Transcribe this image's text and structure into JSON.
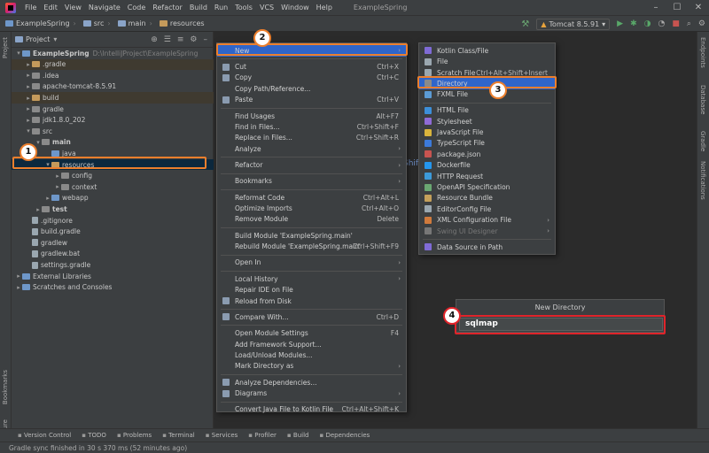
{
  "menubar": {
    "items": [
      "File",
      "Edit",
      "View",
      "Navigate",
      "Code",
      "Refactor",
      "Build",
      "Run",
      "Tools",
      "VCS",
      "Window",
      "Help"
    ],
    "title": "ExampleSpring"
  },
  "navbar": {
    "crumbs": [
      "ExampleSpring",
      "src",
      "main",
      "resources"
    ],
    "run_config": "Tomcat 8.5.91"
  },
  "project": {
    "title": "Project",
    "rows": [
      {
        "label": "ExampleSpring",
        "hint": "D:\\IntelliJProject\\ExampleSpring",
        "indent": 0,
        "arrow": "▾",
        "icon": "b",
        "state": "",
        "bold": true
      },
      {
        "label": ".gradle",
        "indent": 1,
        "arrow": "▸",
        "icon": "o",
        "state": "ex"
      },
      {
        "label": ".idea",
        "indent": 1,
        "arrow": "▸",
        "icon": "g",
        "state": ""
      },
      {
        "label": "apache-tomcat-8.5.91",
        "indent": 1,
        "arrow": "▸",
        "icon": "g",
        "state": ""
      },
      {
        "label": "build",
        "indent": 1,
        "arrow": "▸",
        "icon": "o",
        "state": "ex"
      },
      {
        "label": "gradle",
        "indent": 1,
        "arrow": "▸",
        "icon": "g",
        "state": ""
      },
      {
        "label": "jdk1.8.0_202",
        "indent": 1,
        "arrow": "▸",
        "icon": "g",
        "state": ""
      },
      {
        "label": "src",
        "indent": 1,
        "arrow": "▾",
        "icon": "g",
        "state": ""
      },
      {
        "label": "main",
        "indent": 2,
        "arrow": "▾",
        "icon": "g",
        "state": "",
        "bold": true
      },
      {
        "label": "java",
        "indent": 3,
        "arrow": "",
        "icon": "b",
        "state": ""
      },
      {
        "label": "resources",
        "indent": 3,
        "arrow": "▾",
        "icon": "o",
        "state": "sel"
      },
      {
        "label": "config",
        "indent": 4,
        "arrow": "▸",
        "icon": "g",
        "state": ""
      },
      {
        "label": "context",
        "indent": 4,
        "arrow": "▸",
        "icon": "g",
        "state": ""
      },
      {
        "label": "webapp",
        "indent": 3,
        "arrow": "▸",
        "icon": "b",
        "state": ""
      },
      {
        "label": "test",
        "indent": 2,
        "arrow": "▸",
        "icon": "g",
        "state": "",
        "bold": true
      },
      {
        "label": ".gitignore",
        "indent": 1,
        "arrow": "",
        "icon": "f",
        "state": ""
      },
      {
        "label": "build.gradle",
        "indent": 1,
        "arrow": "",
        "icon": "f",
        "state": ""
      },
      {
        "label": "gradlew",
        "indent": 1,
        "arrow": "",
        "icon": "f",
        "state": ""
      },
      {
        "label": "gradlew.bat",
        "indent": 1,
        "arrow": "",
        "icon": "f",
        "state": ""
      },
      {
        "label": "settings.gradle",
        "indent": 1,
        "arrow": "",
        "icon": "f",
        "state": ""
      },
      {
        "label": "External Libraries",
        "indent": 0,
        "arrow": "▸",
        "icon": "b",
        "state": ""
      },
      {
        "label": "Scratches and Consoles",
        "indent": 0,
        "arrow": "▸",
        "icon": "b",
        "state": ""
      }
    ]
  },
  "context_menu": {
    "items": [
      {
        "label": "New",
        "sc": "",
        "sub": true,
        "hl": true
      },
      {
        "sep": true
      },
      {
        "label": "Cut",
        "sc": "Ctrl+X",
        "icon": "scissors-icon"
      },
      {
        "label": "Copy",
        "sc": "Ctrl+C",
        "icon": "copy-icon"
      },
      {
        "label": "Copy Path/Reference...",
        "sc": ""
      },
      {
        "label": "Paste",
        "sc": "Ctrl+V",
        "icon": "paste-icon"
      },
      {
        "sep": true
      },
      {
        "label": "Find Usages",
        "sc": "Alt+F7"
      },
      {
        "label": "Find in Files...",
        "sc": "Ctrl+Shift+F"
      },
      {
        "label": "Replace in Files...",
        "sc": "Ctrl+Shift+R"
      },
      {
        "label": "Analyze",
        "sc": "",
        "sub": true
      },
      {
        "sep": true
      },
      {
        "label": "Refactor",
        "sc": "",
        "sub": true
      },
      {
        "sep": true
      },
      {
        "label": "Bookmarks",
        "sc": "",
        "sub": true
      },
      {
        "sep": true
      },
      {
        "label": "Reformat Code",
        "sc": "Ctrl+Alt+L"
      },
      {
        "label": "Optimize Imports",
        "sc": "Ctrl+Alt+O"
      },
      {
        "label": "Remove Module",
        "sc": "Delete"
      },
      {
        "sep": true
      },
      {
        "label": "Build Module 'ExampleSpring.main'",
        "sc": ""
      },
      {
        "label": "Rebuild Module 'ExampleSpring.main'",
        "sc": "Ctrl+Shift+F9"
      },
      {
        "sep": true
      },
      {
        "label": "Open In",
        "sc": "",
        "sub": true
      },
      {
        "sep": true
      },
      {
        "label": "Local History",
        "sc": "",
        "sub": true
      },
      {
        "label": "Repair IDE on File",
        "sc": ""
      },
      {
        "label": "Reload from Disk",
        "sc": "",
        "icon": "reload-icon"
      },
      {
        "sep": true
      },
      {
        "label": "Compare With...",
        "sc": "Ctrl+D",
        "icon": "compare-icon"
      },
      {
        "sep": true
      },
      {
        "label": "Open Module Settings",
        "sc": "F4"
      },
      {
        "label": "Add Framework Support...",
        "sc": ""
      },
      {
        "label": "Load/Unload Modules...",
        "sc": ""
      },
      {
        "label": "Mark Directory as",
        "sc": "",
        "sub": true
      },
      {
        "sep": true
      },
      {
        "label": "Analyze Dependencies...",
        "sc": "",
        "icon": "analyze-icon"
      },
      {
        "label": "Diagrams",
        "sc": "",
        "sub": true,
        "icon": "diagram-icon"
      },
      {
        "sep": true
      },
      {
        "label": "Convert Java File to Kotlin File",
        "sc": "Ctrl+Alt+Shift+K"
      }
    ]
  },
  "new_menu": {
    "items": [
      {
        "label": "Kotlin Class/File",
        "sc": ""
      },
      {
        "label": "File",
        "sc": ""
      },
      {
        "label": "Scratch File",
        "sc": "Ctrl+Alt+Shift+Insert"
      },
      {
        "label": "Directory",
        "sc": "",
        "hl": true
      },
      {
        "label": "FXML File",
        "sc": ""
      },
      {
        "sep": true
      },
      {
        "label": "HTML File",
        "sc": ""
      },
      {
        "label": "Stylesheet",
        "sc": ""
      },
      {
        "label": "JavaScript File",
        "sc": ""
      },
      {
        "label": "TypeScript File",
        "sc": ""
      },
      {
        "label": "package.json",
        "sc": ""
      },
      {
        "label": "Dockerfile",
        "sc": ""
      },
      {
        "label": "HTTP Request",
        "sc": ""
      },
      {
        "label": "OpenAPI Specification",
        "sc": ""
      },
      {
        "label": "Resource Bundle",
        "sc": ""
      },
      {
        "label": "EditorConfig File",
        "sc": ""
      },
      {
        "label": "XML Configuration File",
        "sc": "",
        "sub": true
      },
      {
        "label": "Swing UI Designer",
        "sc": "",
        "sub": true,
        "dis": true
      },
      {
        "sep": true
      },
      {
        "label": "Data Source in Path",
        "sc": ""
      }
    ]
  },
  "dialog": {
    "title": "New Directory",
    "value": "sqlmap"
  },
  "bottom_tools": [
    "Version Control",
    "TODO",
    "Problems",
    "Terminal",
    "Services",
    "Profiler",
    "Build",
    "Dependencies"
  ],
  "status": {
    "text": "Gradle sync finished in 30 s 370 ms (52 minutes ago)"
  },
  "right_tabs": [
    "Endpoints",
    "Database",
    "Gradle",
    "Notifications"
  ],
  "left_tabs": [
    "Project",
    "Bookmarks",
    "Structure"
  ],
  "badges": [
    "1",
    "2",
    "3",
    "4"
  ],
  "editor_ghost": "Shift",
  "colors": {
    "accent": "#2f65ca",
    "annot_orange": "#ec7f2d",
    "annot_red": "#e0242a"
  }
}
